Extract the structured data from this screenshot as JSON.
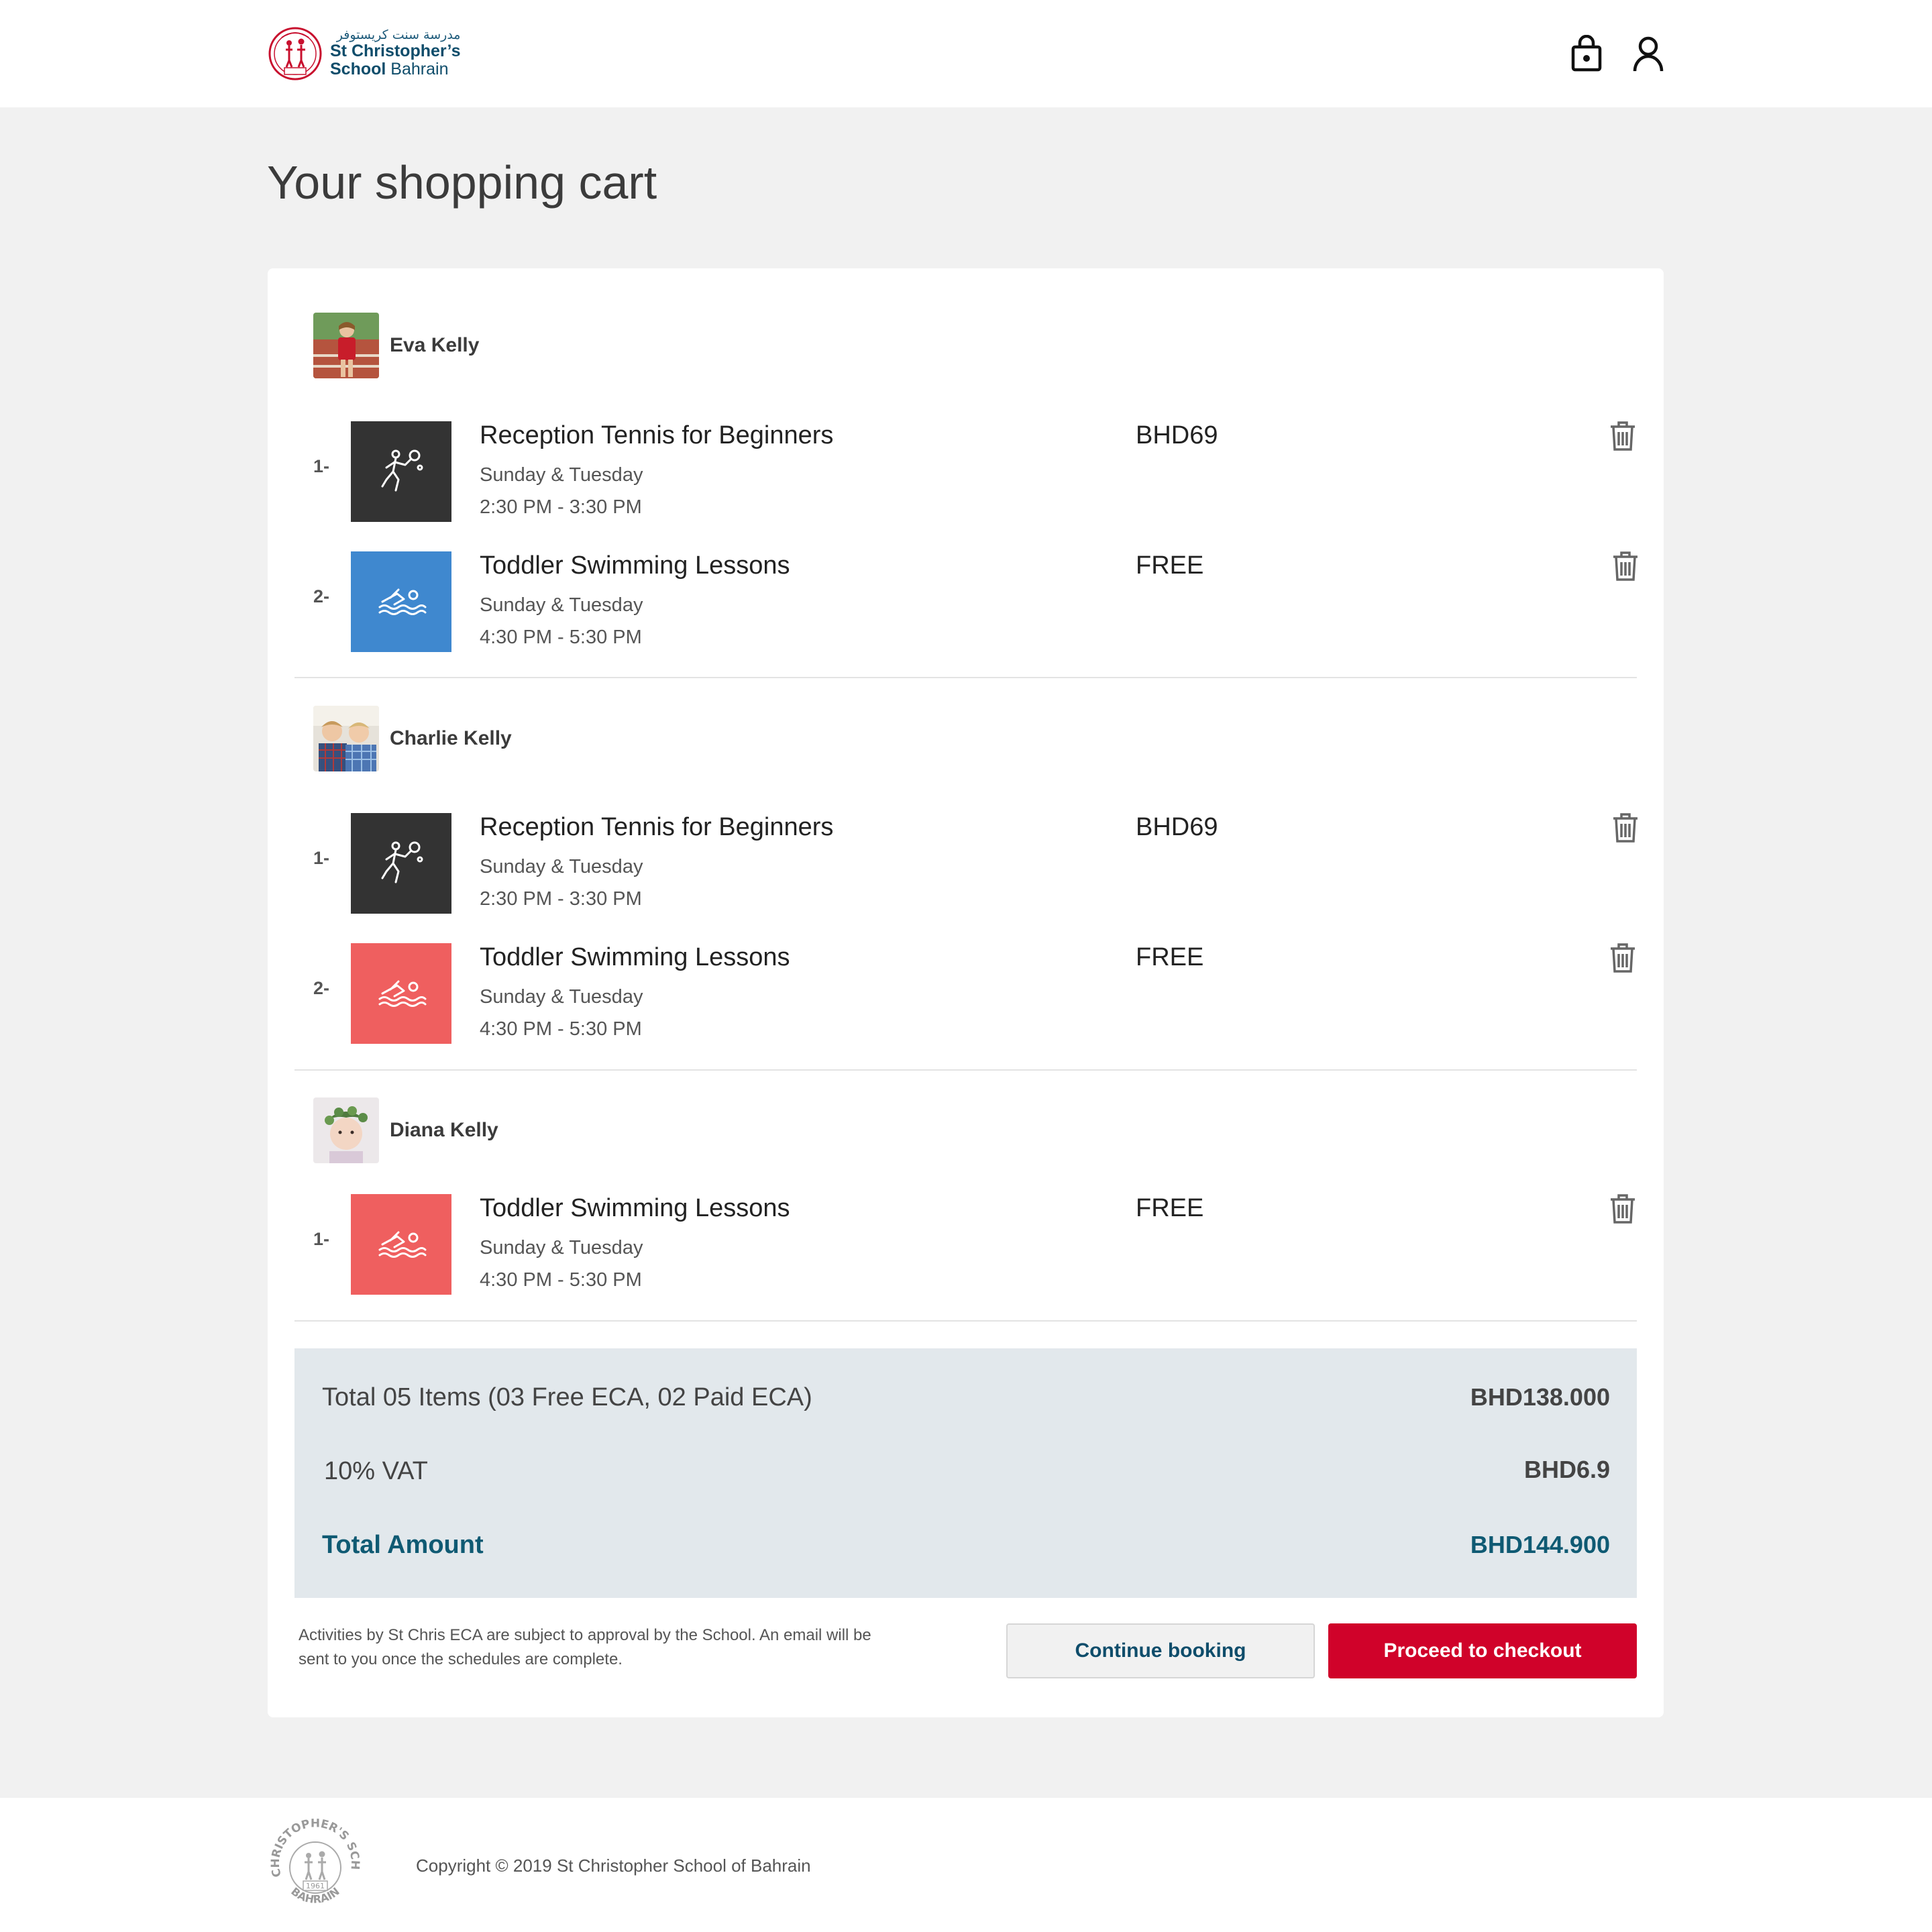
{
  "header": {
    "logo_arabic": "مدرسة سنت كريستوفر",
    "logo_line1": "St Christopher’s",
    "logo_line2_bold": "School",
    "logo_line2_rest": "Bahrain",
    "logo_year": "1961",
    "icons": [
      "shopping-bag-icon",
      "user-icon"
    ]
  },
  "page": {
    "title": "Your shopping cart"
  },
  "students": [
    {
      "name": "Eva Kelly",
      "items": [
        {
          "num": "1-",
          "title": "Reception Tennis for Beginners",
          "days": "Sunday & Tuesday",
          "time": "2:30 PM - 3:30 PM",
          "price": "BHD69",
          "icon": "tennis-player-icon",
          "color": "#333333"
        },
        {
          "num": "2-",
          "title": "Toddler Swimming Lessons",
          "days": "Sunday & Tuesday",
          "time": "4:30 PM - 5:30 PM",
          "price": "FREE",
          "icon": "swimmer-icon",
          "color": "#3f88cf"
        }
      ]
    },
    {
      "name": "Charlie Kelly",
      "items": [
        {
          "num": "1-",
          "title": "Reception Tennis for Beginners",
          "days": "Sunday & Tuesday",
          "time": "2:30 PM - 3:30 PM",
          "price": "BHD69",
          "icon": "tennis-player-icon",
          "color": "#333333"
        },
        {
          "num": "2-",
          "title": "Toddler Swimming Lessons",
          "days": "Sunday & Tuesday",
          "time": "4:30 PM - 5:30 PM",
          "price": "FREE",
          "icon": "swimmer-icon",
          "color": "#ef5f5f"
        }
      ]
    },
    {
      "name": "Diana Kelly",
      "items": [
        {
          "num": "1-",
          "title": "Toddler Swimming Lessons",
          "days": "Sunday & Tuesday",
          "time": "4:30 PM - 5:30 PM",
          "price": "FREE",
          "icon": "swimmer-icon",
          "color": "#ef5f5f"
        }
      ]
    }
  ],
  "summary": {
    "items_label": "Total 05 Items (03 Free ECA, 02 Paid ECA)",
    "items_value": "BHD138.000",
    "vat_label": "10% VAT",
    "vat_value": "BHD6.9",
    "total_label": "Total Amount",
    "total_value": "BHD144.900"
  },
  "note": "Activities by St Chris ECA are subject to approval by the School. An email will be sent to you once the schedules are complete.",
  "buttons": {
    "continue": "Continue booking",
    "checkout": "Proceed to checkout"
  },
  "footer": {
    "copyright": "Copyright © 2019 St Christopher School of Bahrain",
    "seal_text": "ST CHRISTOPHER'S SCHOOL",
    "seal_bottom": "BAHRAIN",
    "seal_year": "1961"
  },
  "colors": {
    "brand_red": "#d0022a",
    "brand_teal": "#0f4d6b",
    "summary_bg": "#e2e8ec"
  }
}
